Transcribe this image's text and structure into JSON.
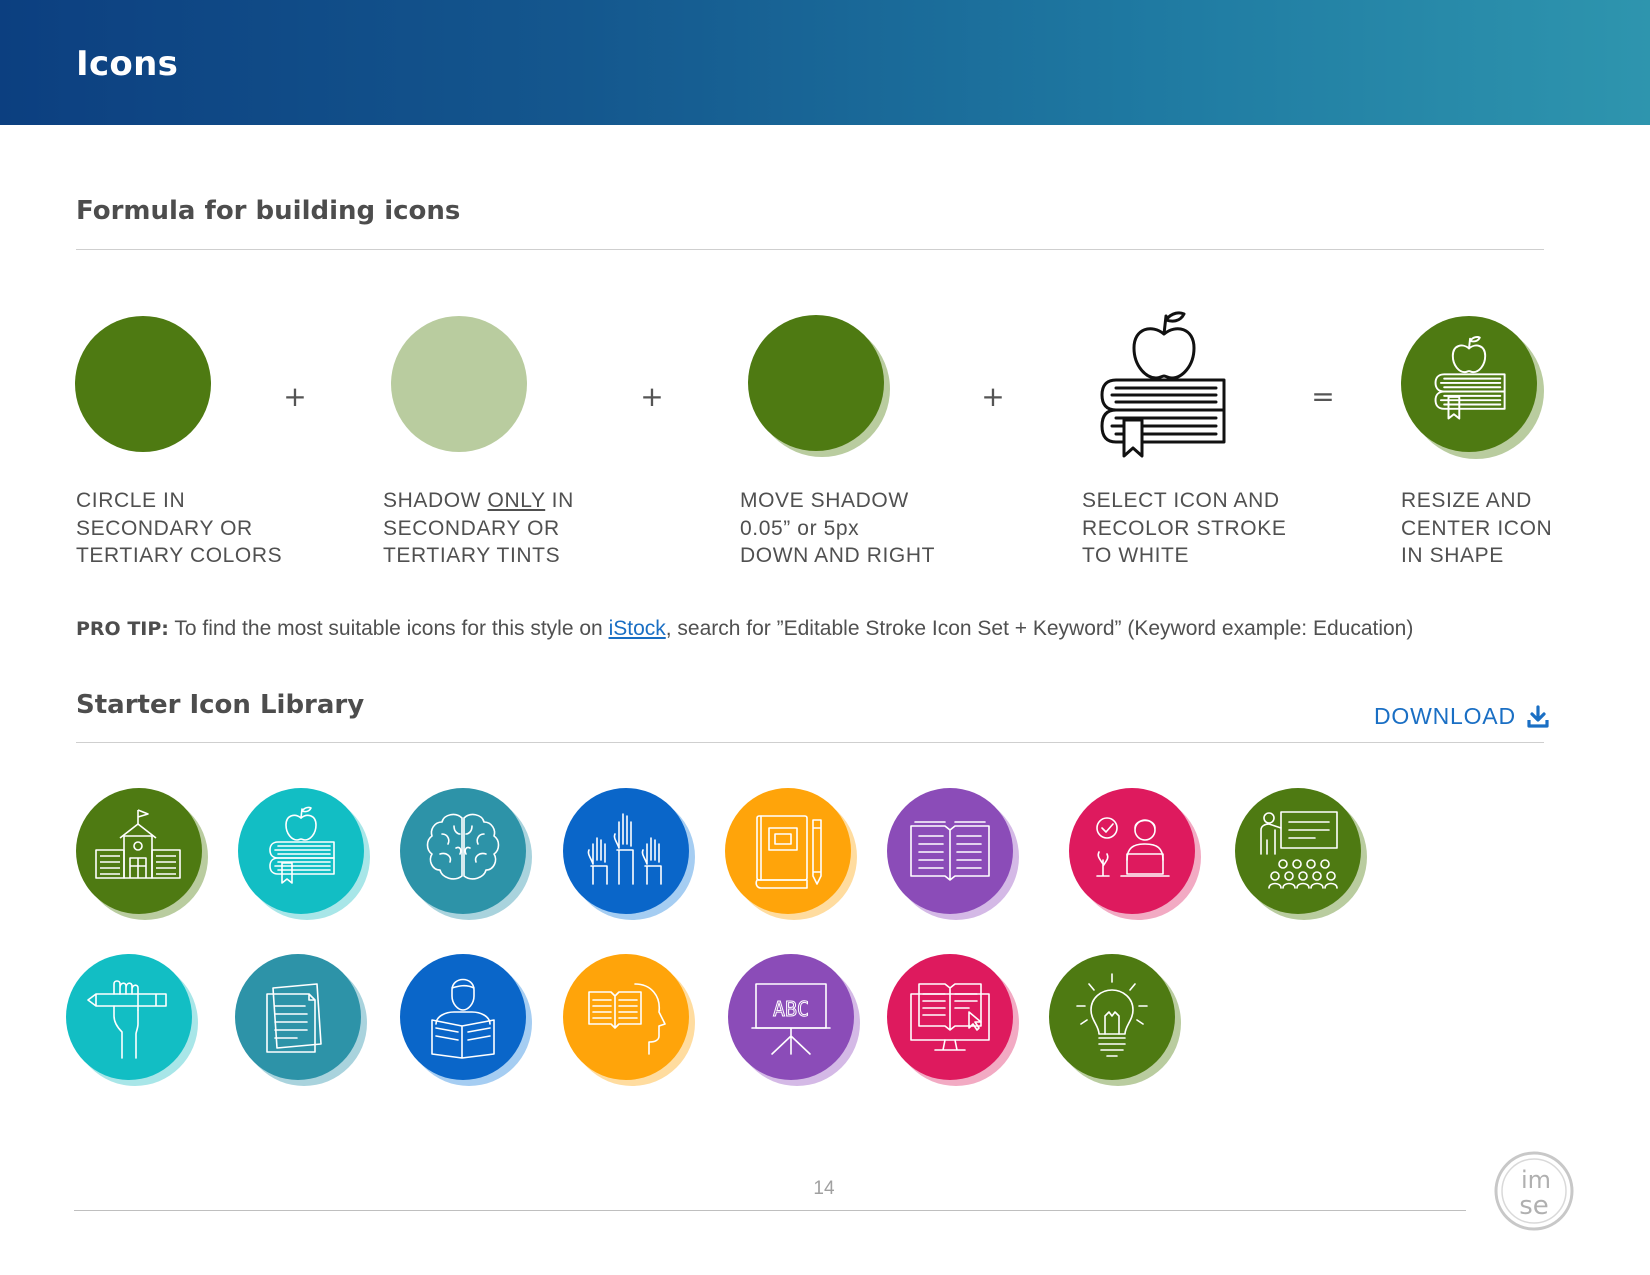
{
  "header": {
    "title": "Icons"
  },
  "formula": {
    "title": "Formula for building icons",
    "operators": {
      "plus": "+",
      "equals": "="
    },
    "steps": [
      {
        "lines": [
          "CIRCLE IN",
          "SECONDARY OR",
          "TERTIARY COLORS"
        ]
      },
      {
        "line1_a": "SHADOW ",
        "line1_b": "ONLY",
        "line1_c": " IN",
        "lines": [
          "SECONDARY OR",
          "TERTIARY TINTS"
        ]
      },
      {
        "lines": [
          "MOVE SHADOW",
          "0.05” or 5px",
          "DOWN AND RIGHT"
        ]
      },
      {
        "lines": [
          "SELECT ICON AND",
          "RECOLOR STROKE",
          "TO WHITE"
        ]
      },
      {
        "lines": [
          "RESIZE AND",
          "CENTER ICON",
          "IN SHAPE"
        ]
      }
    ],
    "colors": {
      "circle": "#4e7a12",
      "shadow_tint": "#b9cc9f"
    }
  },
  "protip": {
    "label": "PRO TIP:",
    "text_before": " To find the most suitable icons for this style on ",
    "link": "iStock",
    "text_after": ", search for ”Editable Stroke Icon Set + Keyword” (Keyword example: Education)"
  },
  "library": {
    "title": "Starter Icon Library",
    "download_label": "DOWNLOAD",
    "download_icon": "download-icon",
    "icons": [
      {
        "name": "school-building-icon",
        "color": "#4e7a12",
        "shadow": "#b9cc9f"
      },
      {
        "name": "apple-on-books-icon",
        "color": "#12bec4",
        "shadow": "#a8e6e8"
      },
      {
        "name": "brain-icon",
        "color": "#2d93a8",
        "shadow": "#a9d3dd"
      },
      {
        "name": "raised-hands-icon",
        "color": "#0a66c9",
        "shadow": "#a5cdf2"
      },
      {
        "name": "book-and-pencil-icon",
        "color": "#ffa40a",
        "shadow": "#ffdc9f"
      },
      {
        "name": "open-book-icon",
        "color": "#8b4cb8",
        "shadow": "#d4b9e6"
      },
      {
        "name": "online-learner-icon",
        "color": "#de1a5e",
        "shadow": "#f2aac3"
      },
      {
        "name": "teacher-with-class-icon",
        "color": "#4e7a12",
        "shadow": "#b9cc9f"
      },
      {
        "name": "hand-holding-pencil-icon",
        "color": "#12bec4",
        "shadow": "#a8e6e8"
      },
      {
        "name": "documents-icon",
        "color": "#2d93a8",
        "shadow": "#a9d3dd"
      },
      {
        "name": "person-reading-icon",
        "color": "#0a66c9",
        "shadow": "#a5cdf2"
      },
      {
        "name": "book-in-mind-icon",
        "color": "#ffa40a",
        "shadow": "#ffdc9f"
      },
      {
        "name": "abc-chalkboard-icon",
        "color": "#8b4cb8",
        "shadow": "#d4b9e6",
        "text": "ABC"
      },
      {
        "name": "ebook-monitor-icon",
        "color": "#de1a5e",
        "shadow": "#f2aac3"
      },
      {
        "name": "lightbulb-icon",
        "color": "#4e7a12",
        "shadow": "#b9cc9f"
      }
    ]
  },
  "footer": {
    "page_number": "14",
    "logo_text_top": "im",
    "logo_text_bottom": "se"
  }
}
